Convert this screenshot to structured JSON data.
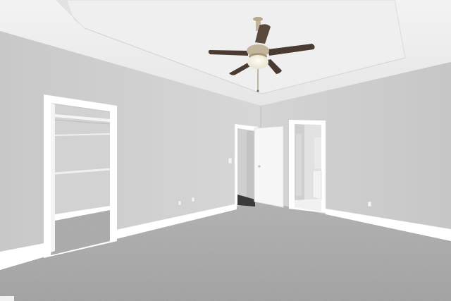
{
  "scene": {
    "type": "photo",
    "colors": {
      "wall_left": "#cfcfcf",
      "wall_right": "#c9c9c9",
      "ceiling": "#ececec",
      "carpet": "#a3a3a3",
      "trim": "#ffffff",
      "fan_blade": "#4a3b32",
      "fan_metal": "#c2b59b"
    },
    "icons": [
      "ceiling-fan-icon",
      "light-switch-icon",
      "outlet-icon"
    ]
  }
}
